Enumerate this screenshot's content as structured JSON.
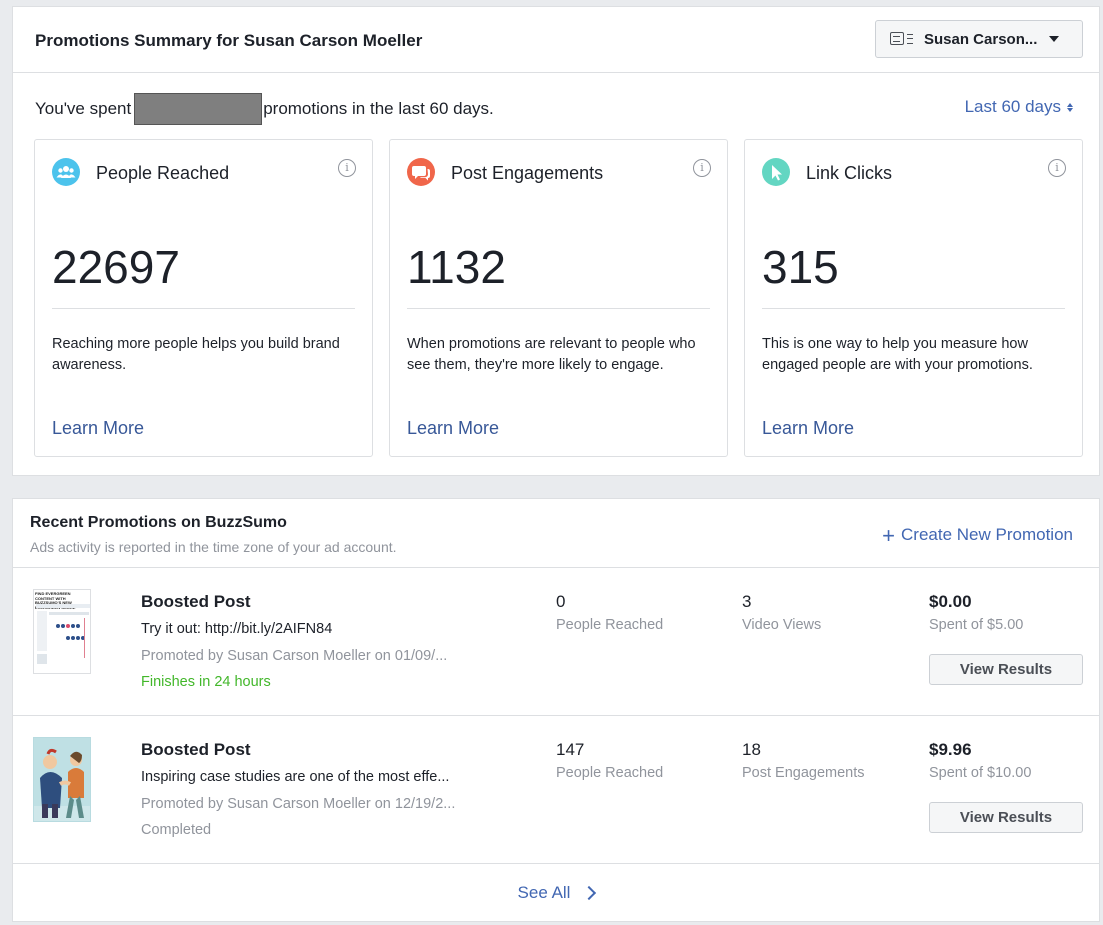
{
  "summary": {
    "title": "Promotions Summary for Susan Carson Moeller",
    "page_selector": "Susan Carson...",
    "spent_prefix": "You've spent",
    "spent_suffix": "promotions in the last 60 days.",
    "range": "Last 60 days"
  },
  "cards": [
    {
      "title": "People Reached",
      "value": "22697",
      "desc": "Reaching more people helps you build brand awareness.",
      "link": "Learn More",
      "icon": "people-icon",
      "color": "#4cc3ec"
    },
    {
      "title": "Post Engagements",
      "value": "1132",
      "desc": "When promotions are relevant to people who see them, they're more likely to engage.",
      "link": "Learn More",
      "icon": "speech-bubbles-icon",
      "color": "#f0664a"
    },
    {
      "title": "Link Clicks",
      "value": "315",
      "desc": "This is one way to help you measure how engaged people are with your promotions.",
      "link": "Learn More",
      "icon": "cursor-icon",
      "color": "#63d6c2"
    }
  ],
  "recent": {
    "title": "Recent Promotions on BuzzSumo",
    "subtitle": "Ads activity is reported in the time zone of your ad account.",
    "create": "Create New Promotion",
    "see_all": "See All"
  },
  "promotions": [
    {
      "title": "Boosted Post",
      "text": "Try it out: http://bit.ly/2AIFN84",
      "by": "Promoted by Susan Carson Moeller on 01/09/...",
      "status": "Finishes in 24 hours",
      "status_color": "#42b72a",
      "stat1_value": "0",
      "stat1_label": "People Reached",
      "stat2_value": "3",
      "stat2_label": "Video Views",
      "spent": "$0.00",
      "spent_of": "Spent of $5.00",
      "button": "View Results",
      "thumb_caption": "FIND EVERGREEN CONTENT WITH BUZZSUMO'S NEW EVERGREEN SCORE"
    },
    {
      "title": "Boosted Post",
      "text": "Inspiring case studies are one of the most effe...",
      "by": "Promoted by Susan Carson Moeller on 12/19/2...",
      "status": "Completed",
      "status_color": "#90949c",
      "stat1_value": "147",
      "stat1_label": "People Reached",
      "stat2_value": "18",
      "stat2_label": "Post Engagements",
      "spent": "$9.96",
      "spent_of": "Spent of $10.00",
      "button": "View Results"
    }
  ]
}
